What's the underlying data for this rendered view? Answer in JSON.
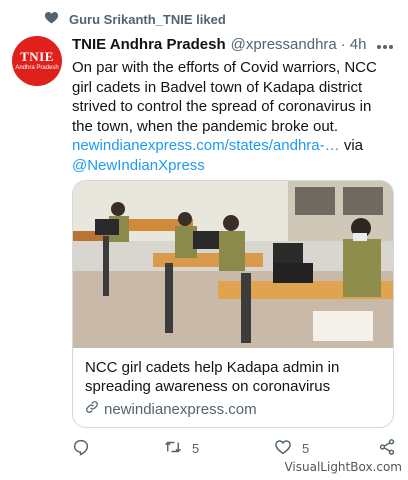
{
  "social_context": {
    "text": "Guru Srikanth_TNIE liked",
    "icon": "heart-icon"
  },
  "author": {
    "avatar_text": "TNIE",
    "avatar_subtext": "Andhra Pradesh",
    "name": "TNIE Andhra Pradesh",
    "handle": "@xpressandhra",
    "separator": "·",
    "time": "4h"
  },
  "more_icon": "more-icon",
  "tweet": {
    "text": "On par with the efforts of Covid warriors, NCC girl cadets in Badvel town of Kadapa district strived to control the spread of coronavirus in the town, when the pandemic broke out.",
    "link": "newindianexpress.com/states/andhra-…",
    "via_label": "via",
    "mention": "@NewIndianXpress"
  },
  "card": {
    "title": "NCC girl cadets help Kadapa admin in spreading awareness on coronavirus",
    "domain": "newindianexpress.com",
    "image_description_icon": "photo-sewing-cadets"
  },
  "actions": {
    "reply_count": "",
    "retweet_count": "5",
    "like_count": "5"
  },
  "watermark": "VisualLightBox.com",
  "colors": {
    "link": "#1d9bf0",
    "secondary_text": "#536471",
    "primary_text": "#0f1419",
    "avatar_bg": "#e0201b"
  }
}
